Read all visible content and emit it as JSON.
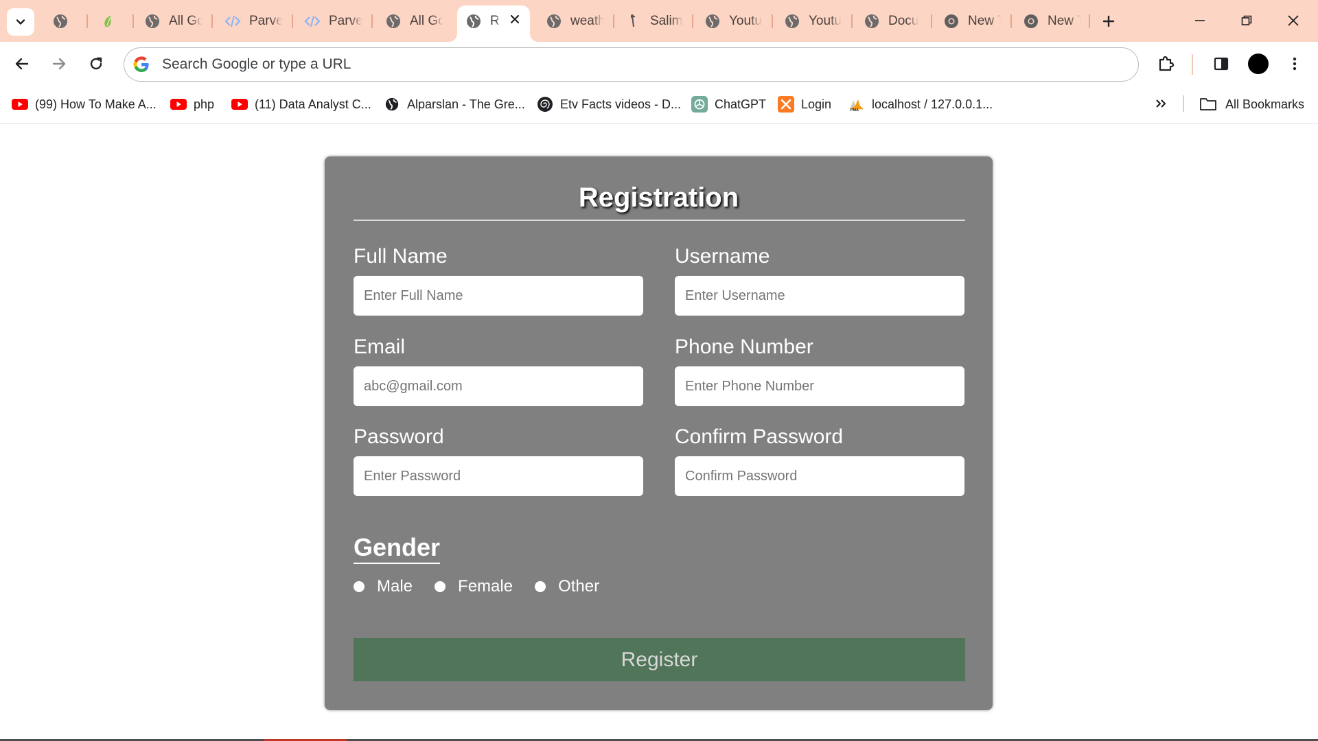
{
  "browser": {
    "tabs": [
      {
        "title": "",
        "icon": "globe-icon"
      },
      {
        "title": "",
        "icon": "leaf-icon"
      },
      {
        "title": "All Go",
        "icon": "globe-icon"
      },
      {
        "title": "Parvej",
        "icon": "code-icon"
      },
      {
        "title": "Parvej",
        "icon": "code-icon"
      },
      {
        "title": "All Go",
        "icon": "globe-icon"
      },
      {
        "title": "R",
        "icon": "globe-icon",
        "active": true
      },
      {
        "title": "weath",
        "icon": "globe-icon"
      },
      {
        "title": "Salim",
        "icon": "stick-icon"
      },
      {
        "title": "Youtu",
        "icon": "globe-icon"
      },
      {
        "title": "Youtu",
        "icon": "globe-icon"
      },
      {
        "title": "Docu",
        "icon": "globe-icon"
      },
      {
        "title": "New T",
        "icon": "chrome-icon"
      },
      {
        "title": "New T",
        "icon": "chrome-icon"
      }
    ],
    "omnibox_placeholder": "Search Google or type a URL",
    "bookmarks": [
      {
        "label": "(99) How To Make A...",
        "icon": "youtube-icon"
      },
      {
        "label": "php",
        "icon": "youtube-icon"
      },
      {
        "label": "(11) Data Analyst C...",
        "icon": "youtube-icon"
      },
      {
        "label": "Alparslan - The Gre...",
        "icon": "globe-icon"
      },
      {
        "label": "Etv Facts videos - D...",
        "icon": "spiral-icon"
      },
      {
        "label": "ChatGPT",
        "icon": "openai-icon"
      },
      {
        "label": "Login",
        "icon": "xampp-icon"
      },
      {
        "label": "localhost / 127.0.0.1...",
        "icon": "phpmyadmin-icon"
      }
    ],
    "all_bookmarks_label": "All Bookmarks",
    "colors": {
      "tabstrip": "#fcd5c4",
      "toolbar": "#ffffff"
    }
  },
  "form": {
    "title": "Registration",
    "fields": {
      "full_name": {
        "label": "Full Name",
        "placeholder": "Enter Full Name"
      },
      "username": {
        "label": "Username",
        "placeholder": "Enter Username"
      },
      "email": {
        "label": "Email",
        "placeholder": "abc@gmail.com"
      },
      "phone": {
        "label": "Phone Number",
        "placeholder": "Enter Phone Number"
      },
      "password": {
        "label": "Password",
        "placeholder": "Enter Password"
      },
      "confirm_password": {
        "label": "Confirm Password",
        "placeholder": "Confirm Password"
      }
    },
    "gender": {
      "title": "Gender",
      "options": [
        "Male",
        "Female",
        "Other"
      ]
    },
    "register_label": "Register",
    "colors": {
      "card": "#808080",
      "button": "#507559",
      "button_text": "#d8d8d8"
    }
  }
}
